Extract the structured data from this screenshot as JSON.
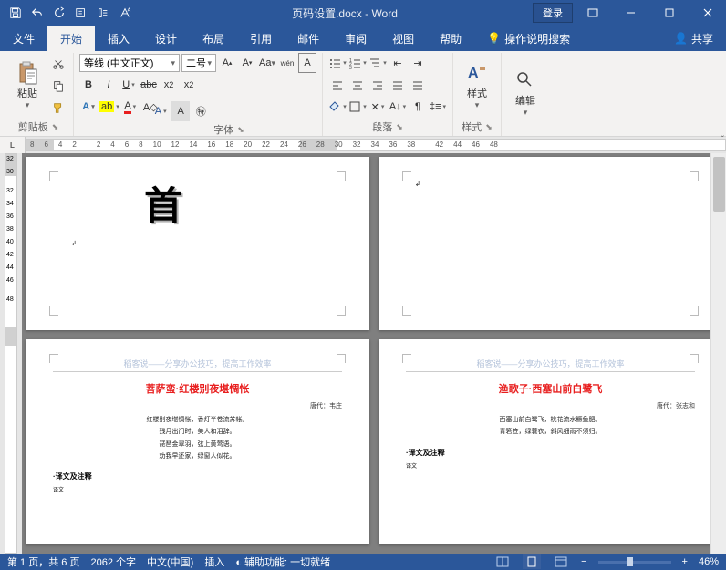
{
  "title": "页码设置.docx - Word",
  "login": "登录",
  "tabs": {
    "file": "文件",
    "home": "开始",
    "insert": "插入",
    "design": "设计",
    "layout": "布局",
    "references": "引用",
    "mailings": "邮件",
    "review": "审阅",
    "view": "视图",
    "help": "帮助",
    "tell": "操作说明搜索",
    "share": "共享"
  },
  "ribbon": {
    "clipboard": {
      "paste": "粘贴",
      "label": "剪贴板"
    },
    "font": {
      "name": "等线 (中文正文)",
      "size": "二号",
      "label": "字体"
    },
    "paragraph": {
      "label": "段落"
    },
    "styles": {
      "btn": "样式",
      "label": "样式"
    },
    "editing": {
      "btn": "编辑"
    }
  },
  "ruler_corner": "L",
  "ruler_marks_h": [
    "8",
    "6",
    "4",
    "2",
    "",
    "2",
    "4",
    "6",
    "8",
    "10",
    "12",
    "14",
    "16",
    "18",
    "20",
    "22",
    "24",
    "26",
    "28",
    "30",
    "32",
    "34",
    "36",
    "38",
    "",
    "42",
    "44",
    "46",
    "48"
  ],
  "ruler_marks_v": [
    "32",
    "30",
    "",
    "32",
    "34",
    "36",
    "38",
    "40",
    "42",
    "44",
    "46",
    "",
    "48"
  ],
  "page1": {
    "char": "首"
  },
  "page3": {
    "header": "稻客说——分享办公技巧，提高工作效率",
    "title": "菩萨蛮·红楼别夜堪惆怅",
    "author": "唐代：韦庄",
    "lines": [
      "红楼别夜堪惆怅，香灯半卷流苏帐。",
      "残月出门时，美人和泪辞。",
      "琵琶金翠羽，弦上黄莺语。",
      "劝我早还家，绿窗人似花。"
    ],
    "sect": "·译文及注释",
    "sub": "译文"
  },
  "page4": {
    "header": "稻客说——分享办公技巧，提高工作效率",
    "title": "渔歌子·西塞山前白鹭飞",
    "author": "唐代：张志和",
    "lines": [
      "西塞山前白鹭飞，桃花流水鳜鱼肥。",
      "青箬笠，绿蓑衣，斜风细雨不须归。"
    ],
    "sect": "·译文及注释",
    "sub": "译文"
  },
  "status": {
    "page": "第 1 页，共 6 页",
    "words": "2062 个字",
    "lang": "中文(中国)",
    "insert": "插入",
    "accessibility": "辅助功能: 一切就绪",
    "zoom": "46%"
  }
}
